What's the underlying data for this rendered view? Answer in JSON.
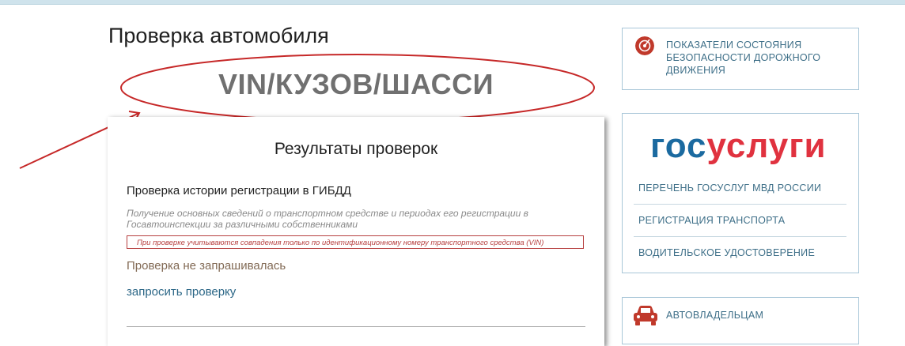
{
  "page": {
    "title": "Проверка автомобиля"
  },
  "highlight": {
    "text": "VIN/КУЗОВ/ШАССИ"
  },
  "results": {
    "title": "Результаты проверок",
    "check": {
      "title": "Проверка истории регистрации в ГИБДД",
      "description": "Получение основных сведений о транспортном средстве и периодах его регистрации в Госавтоинспекции за различными собственниками",
      "vin_note": "При проверке учитываются совпадения только по идентификационному номеру транспортного средства (VIN)",
      "status": "Проверка не запрашивалась",
      "request_link": "запросить проверку"
    }
  },
  "sidebar": {
    "safety": {
      "icon": "target-icon",
      "label": "ПОКАЗАТЕЛИ СОСТОЯНИЯ БЕЗОПАСНОСТИ ДОРОЖНОГО ДВИЖЕНИЯ"
    },
    "gosuslugi": {
      "logo_part1": "гос",
      "logo_part2": "услуги",
      "links": [
        "ПЕРЕЧЕНЬ ГОСУСЛУГ МВД РОССИИ",
        "РЕГИСТРАЦИЯ ТРАНСПОРТА",
        "ВОДИТЕЛЬСКОЕ УДОСТОВЕРЕНИЕ"
      ]
    },
    "owners": {
      "icon": "car-icon",
      "label": "АВТОВЛАДЕЛЬЦАМ"
    }
  },
  "colors": {
    "accent_red": "#c0392b",
    "link_blue": "#3e6f88",
    "brand_blue": "#1b6aa0",
    "brand_red": "#e0323f"
  }
}
